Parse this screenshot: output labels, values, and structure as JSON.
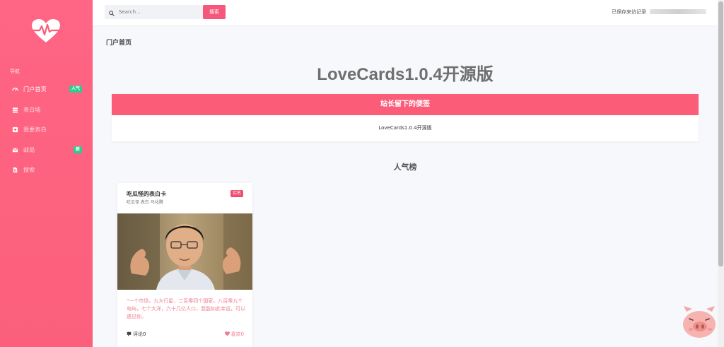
{
  "sidebar": {
    "nav_heading": "导航",
    "items": [
      {
        "label": "门户首页",
        "badge": "人气",
        "icon": "dashboard-icon"
      },
      {
        "label": "表白墙",
        "badge": "",
        "icon": "stack-icon"
      },
      {
        "label": "我要表白",
        "badge": "",
        "icon": "plus-square-icon"
      },
      {
        "label": "邮局",
        "badge": "新",
        "icon": "mail-icon"
      },
      {
        "label": "搜索",
        "badge": "",
        "icon": "search-file-icon"
      }
    ]
  },
  "header": {
    "search_placeholder": "Search...",
    "search_button": "搜索",
    "visit_label": "已保存来访记录"
  },
  "main": {
    "breadcrumb": "门户首页",
    "hero_title": "LoveCards1.0.4开源版",
    "notice_title": "站长留下的便签",
    "notice_body": "LoveCards1.0.4开源版",
    "section_title": "人气榜"
  },
  "card": {
    "title": "吃瓜怪的表白卡",
    "subtitle": "吃瓜怪 表白 马化腾",
    "tag": "实名",
    "text": "\"一个市场，九大行星，二百零四个国家，八百零九个岛屿，七个大洋，六十几亿人口，我能如此幸运，可以遇见你。",
    "comment": "评论0",
    "like": "喜欢0"
  },
  "colors": {
    "brand": "#fb5d79",
    "badge_green": "#2ecc8f",
    "card_text": "#f07d93"
  }
}
